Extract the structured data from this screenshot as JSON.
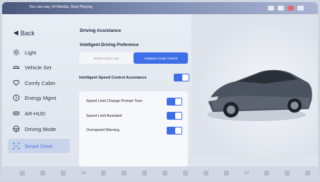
{
  "status_bar": {
    "voice_text": "You can say, Hi Mazda, Stop Playing"
  },
  "sidebar": {
    "back_label": "Back",
    "items": [
      {
        "label": "Light",
        "icon": "sun-icon"
      },
      {
        "label": "Vehicle Set",
        "icon": "car-outline-icon"
      },
      {
        "label": "Comfy Cabin",
        "icon": "heart-icon"
      },
      {
        "label": "Energy Mgmt",
        "icon": "energy-gauge-icon"
      },
      {
        "label": "AR-HUD",
        "icon": "hud-icon"
      },
      {
        "label": "Driving Mode",
        "icon": "steering-wheel-icon"
      },
      {
        "label": "Smart Drive",
        "icon": "smart-drive-icon"
      }
    ],
    "active_index": 6
  },
  "main": {
    "title": "Driving Assistance",
    "preference_title": "Intelligent Driving Preference",
    "preference_options": [
      "Smart Cruise Asst",
      "Adaptive Cruise Control"
    ],
    "preference_selected": "Adaptive Cruise Control",
    "speed_control_label": "Intelligent Speed Control Assistance",
    "speed_control_on": true,
    "card_rows": [
      {
        "label": "Speed Limit Change Prompt Tone",
        "on": true
      },
      {
        "label": "Speed Limit Assistant",
        "on": true
      },
      {
        "label": "Overspeed Warning",
        "on": true
      }
    ]
  },
  "dock": {
    "items": [
      "",
      "",
      "",
      "24",
      "",
      "",
      "",
      "",
      "",
      "",
      "",
      "24",
      "",
      "",
      ""
    ]
  },
  "colors": {
    "accent": "#3f6fe8",
    "status_bar": "#4a567a",
    "background": "#e9edf4"
  }
}
